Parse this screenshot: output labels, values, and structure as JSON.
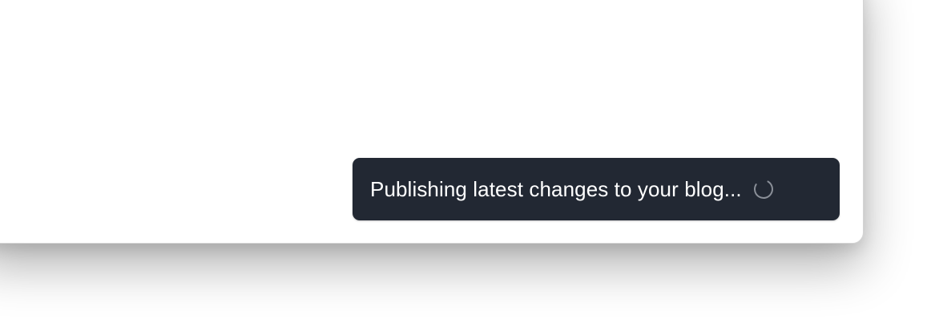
{
  "toast": {
    "message": "Publishing latest changes to your blog...",
    "status_icon": "loading-spinner-icon",
    "background_color": "#222833",
    "text_color": "#ffffff"
  }
}
